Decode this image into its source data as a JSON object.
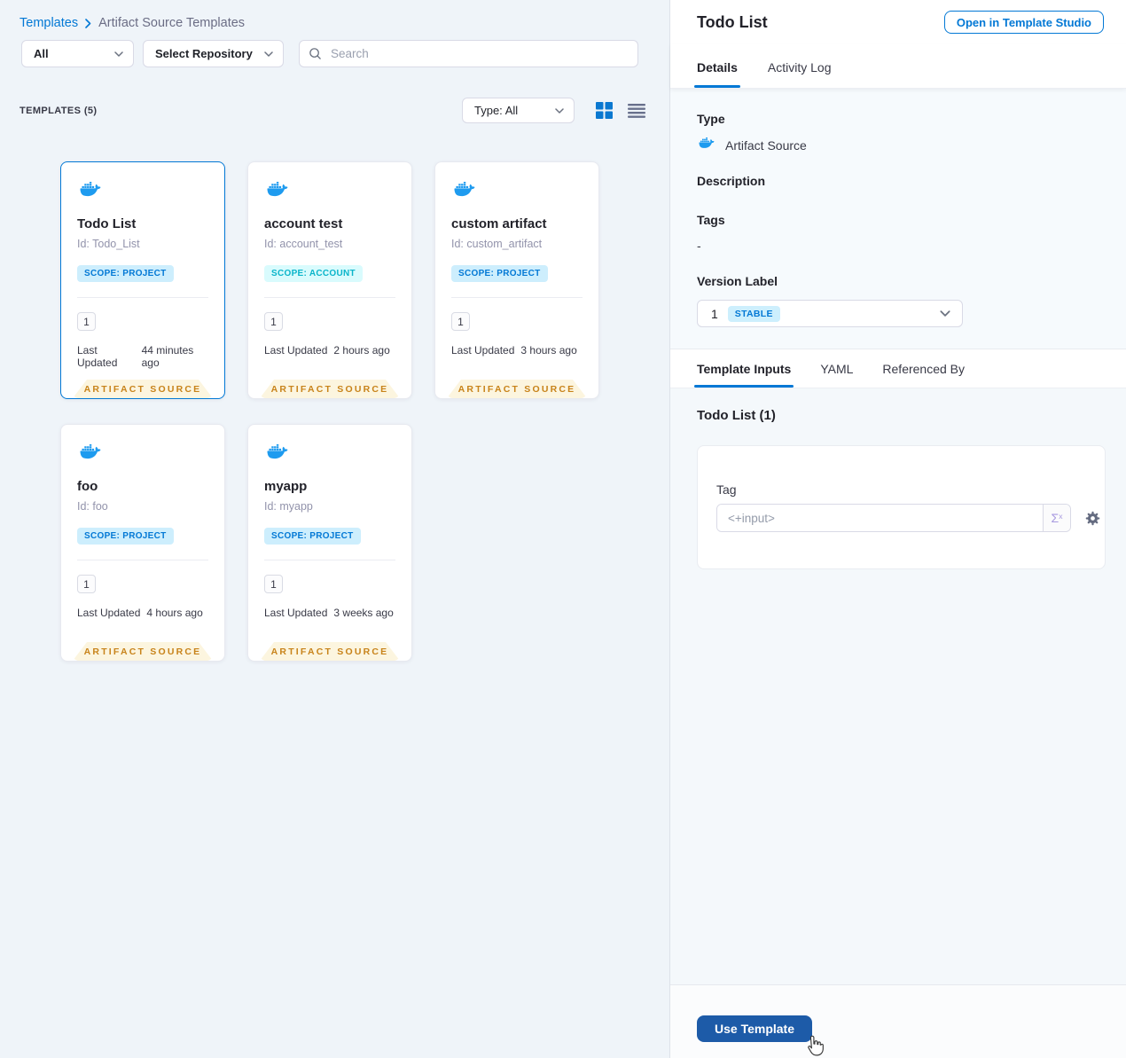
{
  "colors": {
    "primary": "#0278d5",
    "docker_blue": "#1e9bef",
    "scope_project_bg": "#cdeefd",
    "scope_project_text": "#0278d5",
    "scope_account_bg": "#d9fbfd",
    "scope_account_text": "#0ab5ca",
    "ribbon_bg": "#fcf5df",
    "ribbon_text": "#c8831a",
    "stable_badge_bg": "#cdeffd",
    "use_template_bg": "#1d5ba8",
    "left_background": "#eff4f9"
  },
  "breadcrumb": {
    "link": "Templates",
    "current": "Artifact Source Templates"
  },
  "filters": {
    "scope_value": "All",
    "repository_value": "Select Repository",
    "search_placeholder": "Search"
  },
  "list_header": {
    "count_label": "TEMPLATES (5)",
    "type_filter_value": "Type: All"
  },
  "labels": {
    "last_updated": "Last Updated",
    "artifact_source": "ARTIFACT SOURCE"
  },
  "cards": [
    {
      "title": "Todo List",
      "id": "Id: Todo_List",
      "scope": "SCOPE: PROJECT",
      "version": "1",
      "last_updated": "44 minutes ago"
    },
    {
      "title": "account test",
      "id": "Id: account_test",
      "scope": "SCOPE: ACCOUNT",
      "version": "1",
      "last_updated": "2 hours ago"
    },
    {
      "title": "custom artifact",
      "id": "Id: custom_artifact",
      "scope": "SCOPE: PROJECT",
      "version": "1",
      "last_updated": "3 hours ago"
    },
    {
      "title": "foo",
      "id": "Id: foo",
      "scope": "SCOPE: PROJECT",
      "version": "1",
      "last_updated": "4 hours ago"
    },
    {
      "title": "myapp",
      "id": "Id: myapp",
      "scope": "SCOPE: PROJECT",
      "version": "1",
      "last_updated": "3 weeks ago"
    }
  ],
  "panel": {
    "title": "Todo List",
    "open_button": "Open in Template Studio",
    "tabs": [
      "Details",
      "Activity Log"
    ],
    "details": {
      "type_label": "Type",
      "type_value": "Artifact Source",
      "description_label": "Description",
      "tags_label": "Tags",
      "tags_value": "-",
      "version_label": "Version Label",
      "version_value": "1",
      "version_badge": "STABLE"
    },
    "inner_tabs": [
      "Template Inputs",
      "YAML",
      "Referenced By"
    ],
    "inputs": {
      "heading": "Todo List (1)",
      "tag_label": "Tag",
      "tag_placeholder": "<+input>",
      "expression_sigma": "Σ",
      "expression_sup": "x"
    },
    "footer": {
      "use_template": "Use Template"
    }
  }
}
